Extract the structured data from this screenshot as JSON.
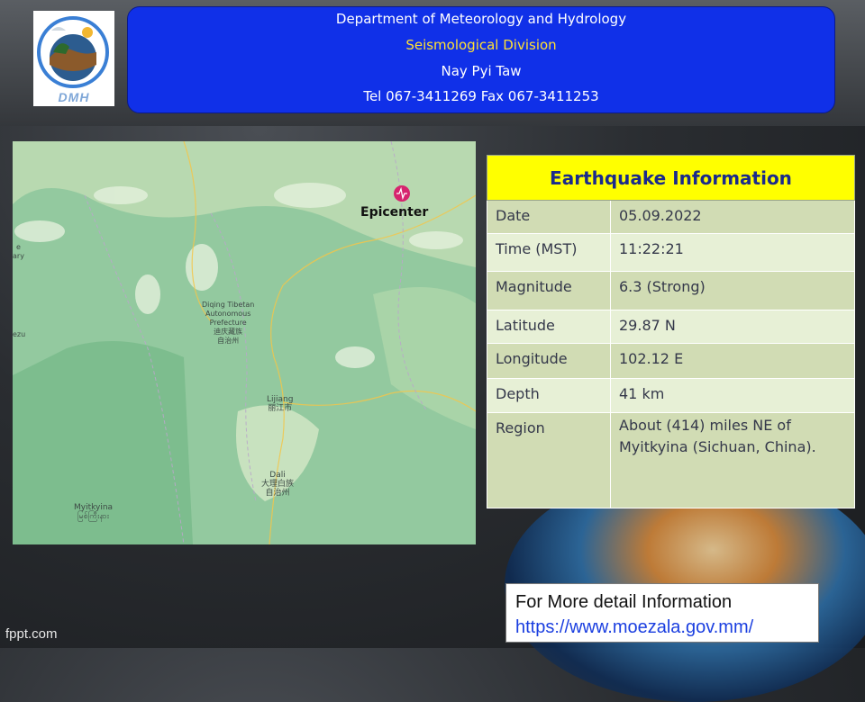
{
  "header": {
    "logo_text": "DMH",
    "line1": "Department of Meteorology and Hydrology",
    "line2": "Seismological Division",
    "line3": "Nay Pyi Taw",
    "line4": "Tel 067-3411269 Fax 067-3411253"
  },
  "map": {
    "epicenter_label": "Epicenter",
    "places": [
      {
        "name": "Diqing Tibetan\nAutonomous\nPrefecture\n迪庆藏族\n自治州"
      },
      {
        "name": "Lijiang\n丽江市"
      },
      {
        "name": "Dali\n大理白族\n自治州"
      },
      {
        "name": "Myitkyina\nမြစ်ကြီးနား"
      },
      {
        "name": "ezu"
      },
      {
        "name": "e\nary"
      }
    ]
  },
  "info": {
    "title": "Earthquake Information",
    "rows": [
      {
        "label": "Date",
        "value": "05.09.2022"
      },
      {
        "label": "Time (MST)",
        "value": "11:22:21"
      },
      {
        "label": "Magnitude",
        "value": "6.3 (Strong)"
      },
      {
        "label": "Latitude",
        "value": "29.87 N"
      },
      {
        "label": "Longitude",
        "value": "102.12 E"
      },
      {
        "label": "Depth",
        "value": "41 km"
      },
      {
        "label": "Region",
        "value": "About (414) miles NE of Myitkyina (Sichuan, China)."
      }
    ]
  },
  "footer": {
    "more_title": "For More detail Information",
    "more_link": "https://www.moezala.gov.mm/",
    "credit": "fppt.com"
  },
  "colors": {
    "title_box": "#1030e8",
    "table_header": "#ffff00",
    "row_dark": "#d1dcb4",
    "row_light": "#e7f0d6",
    "epicenter_marker": "#d6246e"
  }
}
